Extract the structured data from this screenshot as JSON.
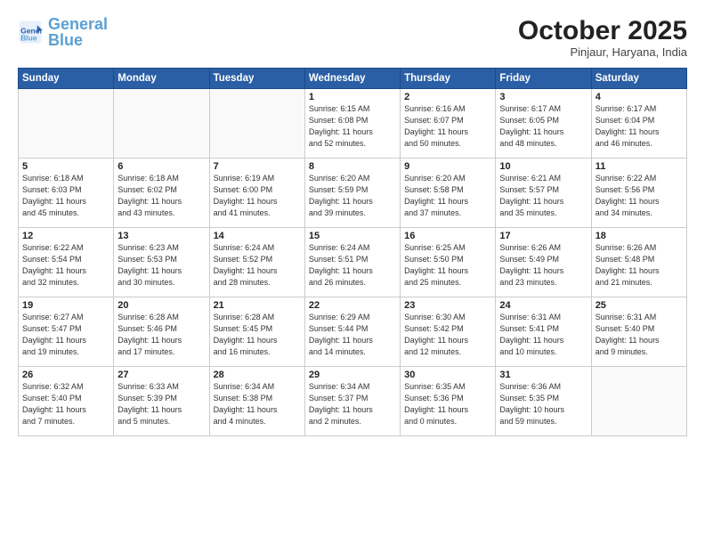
{
  "header": {
    "logo_general": "General",
    "logo_blue": "Blue",
    "month_title": "October 2025",
    "subtitle": "Pinjaur, Haryana, India"
  },
  "days_of_week": [
    "Sunday",
    "Monday",
    "Tuesday",
    "Wednesday",
    "Thursday",
    "Friday",
    "Saturday"
  ],
  "weeks": [
    [
      {
        "day": "",
        "info": ""
      },
      {
        "day": "",
        "info": ""
      },
      {
        "day": "",
        "info": ""
      },
      {
        "day": "1",
        "info": "Sunrise: 6:15 AM\nSunset: 6:08 PM\nDaylight: 11 hours\nand 52 minutes."
      },
      {
        "day": "2",
        "info": "Sunrise: 6:16 AM\nSunset: 6:07 PM\nDaylight: 11 hours\nand 50 minutes."
      },
      {
        "day": "3",
        "info": "Sunrise: 6:17 AM\nSunset: 6:05 PM\nDaylight: 11 hours\nand 48 minutes."
      },
      {
        "day": "4",
        "info": "Sunrise: 6:17 AM\nSunset: 6:04 PM\nDaylight: 11 hours\nand 46 minutes."
      }
    ],
    [
      {
        "day": "5",
        "info": "Sunrise: 6:18 AM\nSunset: 6:03 PM\nDaylight: 11 hours\nand 45 minutes."
      },
      {
        "day": "6",
        "info": "Sunrise: 6:18 AM\nSunset: 6:02 PM\nDaylight: 11 hours\nand 43 minutes."
      },
      {
        "day": "7",
        "info": "Sunrise: 6:19 AM\nSunset: 6:00 PM\nDaylight: 11 hours\nand 41 minutes."
      },
      {
        "day": "8",
        "info": "Sunrise: 6:20 AM\nSunset: 5:59 PM\nDaylight: 11 hours\nand 39 minutes."
      },
      {
        "day": "9",
        "info": "Sunrise: 6:20 AM\nSunset: 5:58 PM\nDaylight: 11 hours\nand 37 minutes."
      },
      {
        "day": "10",
        "info": "Sunrise: 6:21 AM\nSunset: 5:57 PM\nDaylight: 11 hours\nand 35 minutes."
      },
      {
        "day": "11",
        "info": "Sunrise: 6:22 AM\nSunset: 5:56 PM\nDaylight: 11 hours\nand 34 minutes."
      }
    ],
    [
      {
        "day": "12",
        "info": "Sunrise: 6:22 AM\nSunset: 5:54 PM\nDaylight: 11 hours\nand 32 minutes."
      },
      {
        "day": "13",
        "info": "Sunrise: 6:23 AM\nSunset: 5:53 PM\nDaylight: 11 hours\nand 30 minutes."
      },
      {
        "day": "14",
        "info": "Sunrise: 6:24 AM\nSunset: 5:52 PM\nDaylight: 11 hours\nand 28 minutes."
      },
      {
        "day": "15",
        "info": "Sunrise: 6:24 AM\nSunset: 5:51 PM\nDaylight: 11 hours\nand 26 minutes."
      },
      {
        "day": "16",
        "info": "Sunrise: 6:25 AM\nSunset: 5:50 PM\nDaylight: 11 hours\nand 25 minutes."
      },
      {
        "day": "17",
        "info": "Sunrise: 6:26 AM\nSunset: 5:49 PM\nDaylight: 11 hours\nand 23 minutes."
      },
      {
        "day": "18",
        "info": "Sunrise: 6:26 AM\nSunset: 5:48 PM\nDaylight: 11 hours\nand 21 minutes."
      }
    ],
    [
      {
        "day": "19",
        "info": "Sunrise: 6:27 AM\nSunset: 5:47 PM\nDaylight: 11 hours\nand 19 minutes."
      },
      {
        "day": "20",
        "info": "Sunrise: 6:28 AM\nSunset: 5:46 PM\nDaylight: 11 hours\nand 17 minutes."
      },
      {
        "day": "21",
        "info": "Sunrise: 6:28 AM\nSunset: 5:45 PM\nDaylight: 11 hours\nand 16 minutes."
      },
      {
        "day": "22",
        "info": "Sunrise: 6:29 AM\nSunset: 5:44 PM\nDaylight: 11 hours\nand 14 minutes."
      },
      {
        "day": "23",
        "info": "Sunrise: 6:30 AM\nSunset: 5:42 PM\nDaylight: 11 hours\nand 12 minutes."
      },
      {
        "day": "24",
        "info": "Sunrise: 6:31 AM\nSunset: 5:41 PM\nDaylight: 11 hours\nand 10 minutes."
      },
      {
        "day": "25",
        "info": "Sunrise: 6:31 AM\nSunset: 5:40 PM\nDaylight: 11 hours\nand 9 minutes."
      }
    ],
    [
      {
        "day": "26",
        "info": "Sunrise: 6:32 AM\nSunset: 5:40 PM\nDaylight: 11 hours\nand 7 minutes."
      },
      {
        "day": "27",
        "info": "Sunrise: 6:33 AM\nSunset: 5:39 PM\nDaylight: 11 hours\nand 5 minutes."
      },
      {
        "day": "28",
        "info": "Sunrise: 6:34 AM\nSunset: 5:38 PM\nDaylight: 11 hours\nand 4 minutes."
      },
      {
        "day": "29",
        "info": "Sunrise: 6:34 AM\nSunset: 5:37 PM\nDaylight: 11 hours\nand 2 minutes."
      },
      {
        "day": "30",
        "info": "Sunrise: 6:35 AM\nSunset: 5:36 PM\nDaylight: 11 hours\nand 0 minutes."
      },
      {
        "day": "31",
        "info": "Sunrise: 6:36 AM\nSunset: 5:35 PM\nDaylight: 10 hours\nand 59 minutes."
      },
      {
        "day": "",
        "info": ""
      }
    ]
  ]
}
